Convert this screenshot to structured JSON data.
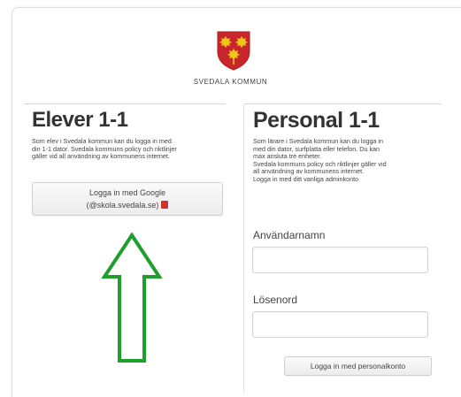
{
  "brand": {
    "name": "SVEDALA KOMMUN",
    "crest_icon": "svedala-crest-icon",
    "colors": {
      "crest_red": "#c8262a",
      "crest_gold": "#f0c419"
    }
  },
  "students": {
    "title": "Elever 1-1",
    "description": [
      "Som elev i Svedala kommun kan du logga in med",
      "din 1-1 dator. Svedala kommuns policy och riktlinjer",
      "gäller vid all användning av kommunens internet."
    ],
    "google_button": {
      "line1": "Logga in med Google",
      "line2": "(@skola.svedala.se)",
      "icon": "google-apps-icon"
    }
  },
  "staff": {
    "title": "Personal 1-1",
    "description": [
      "Som lärare i Svedala kommun kan du logga in",
      "med din dator, surfplatta eller telefon. Du kan",
      "max ansluta tre enheter.",
      "Svedala kommuns policy och riktlinjer gäller vid",
      "all användning av kommunens internet.",
      "Logga in med ditt vanliga adminkonto"
    ],
    "username_label": "Användarnamn",
    "username_value": "",
    "password_label": "Lösenord",
    "password_value": "",
    "submit_label": "Logga in med personalkonto"
  },
  "annotation": {
    "icon": "up-arrow-outline-icon",
    "color": "#1e9e2c"
  }
}
